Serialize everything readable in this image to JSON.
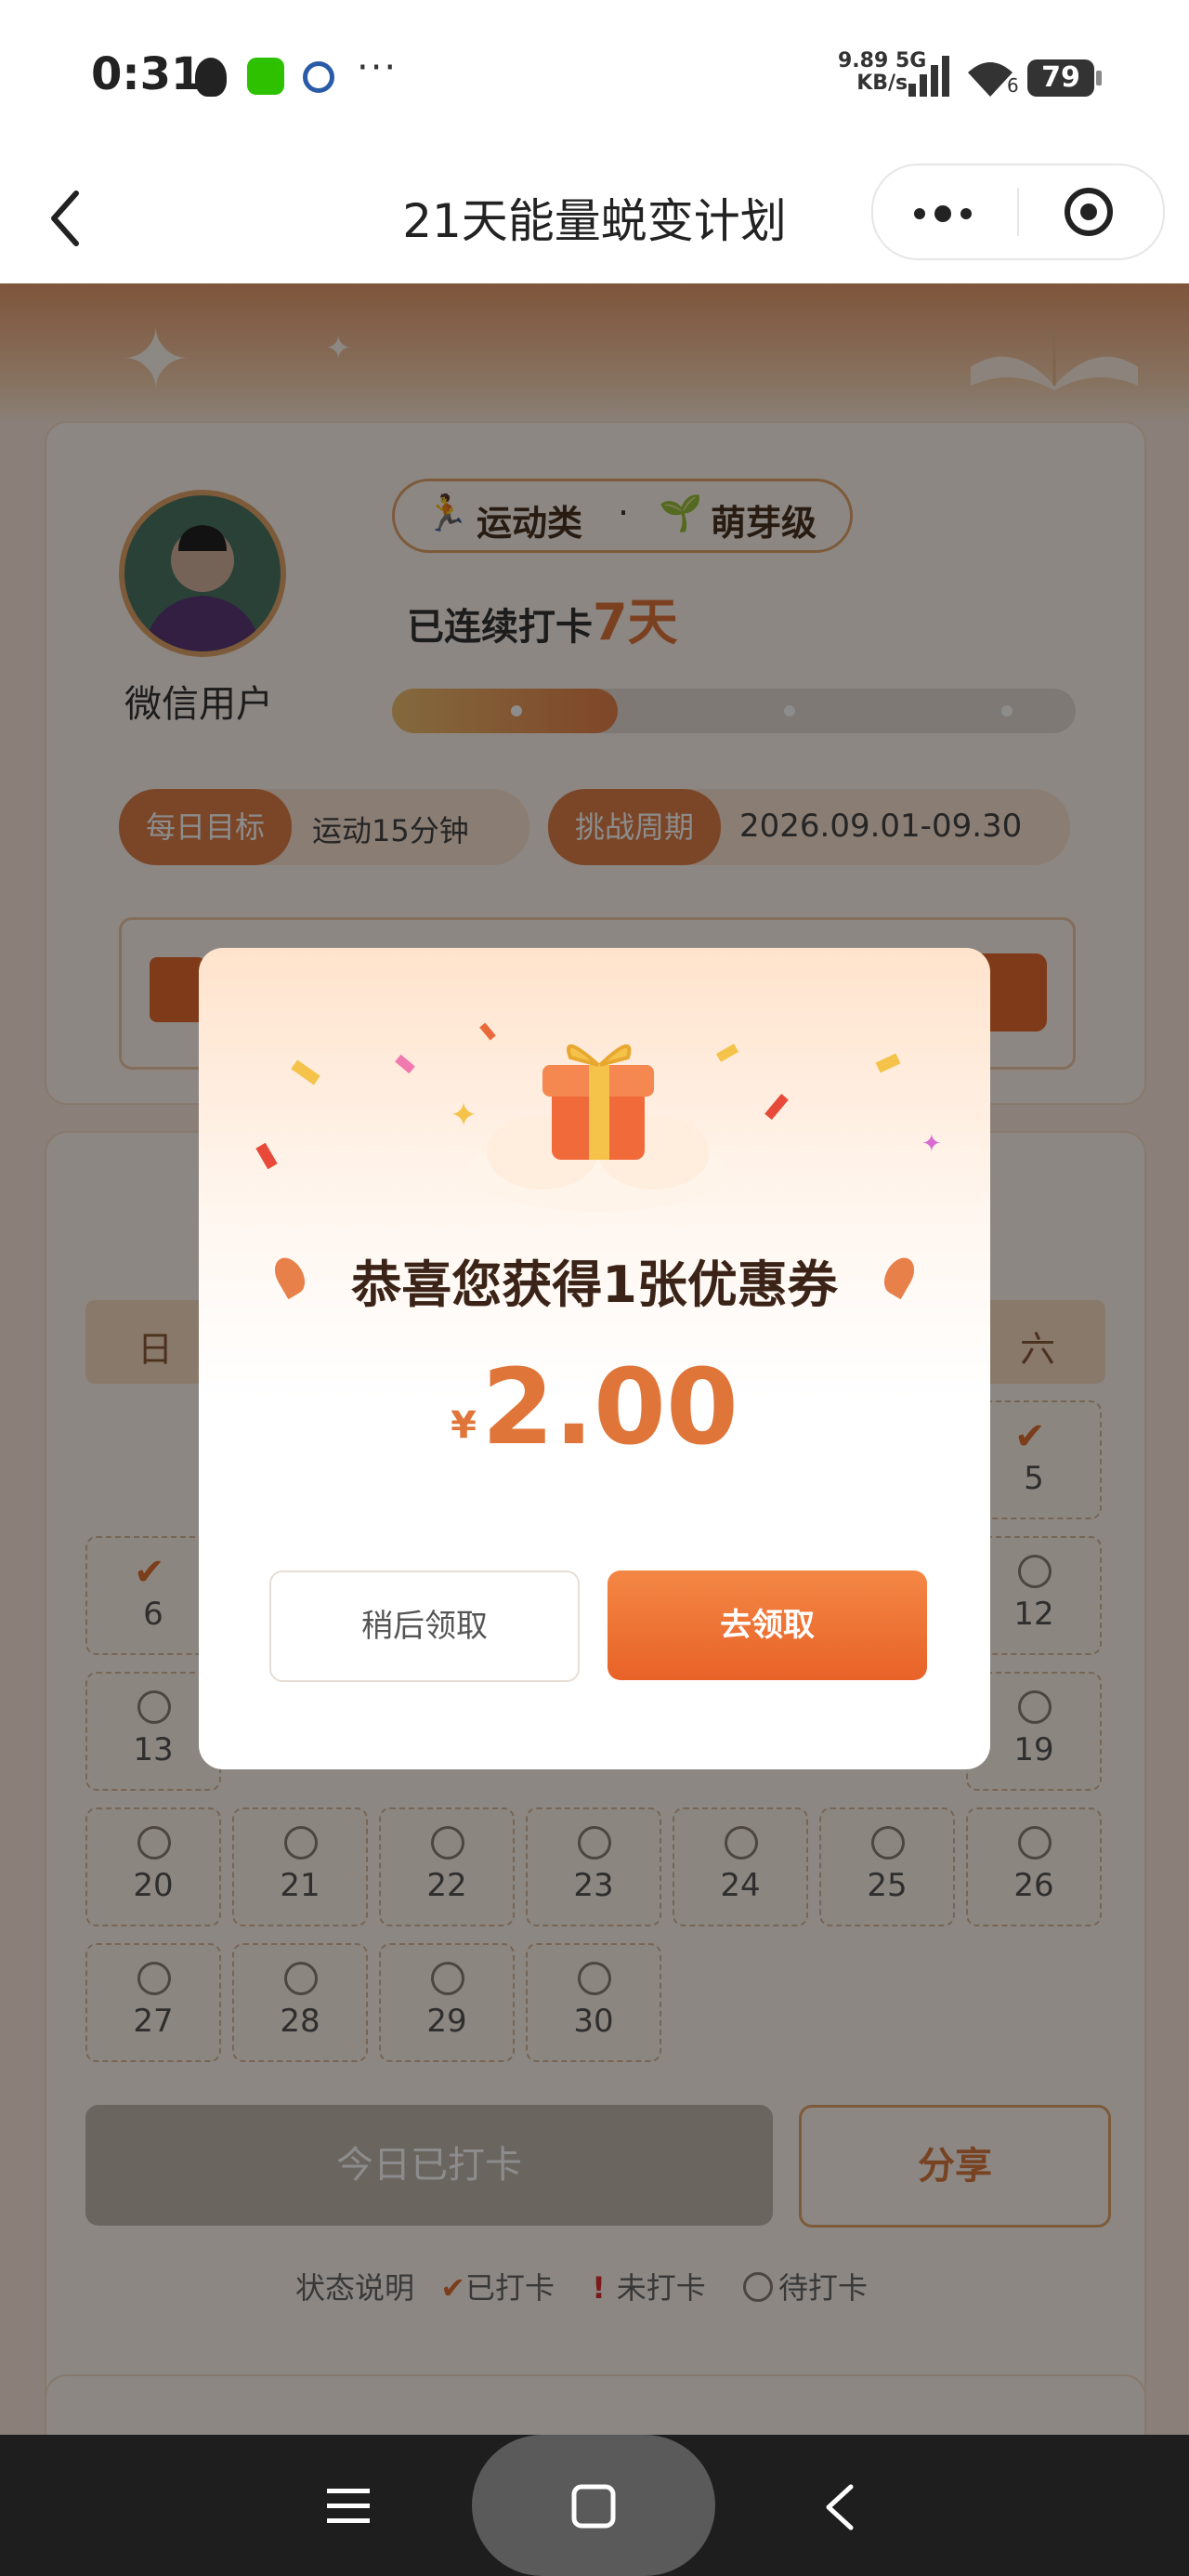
{
  "status_bar": {
    "time": "0:31",
    "dots": "···",
    "net_speed": "9.89",
    "net_unit": "KB/s",
    "net_type": "5G",
    "wifi_sub": "6",
    "battery": "79"
  },
  "navbar": {
    "title": "21天能量蜕变计划"
  },
  "profile": {
    "username": "微信用户",
    "category": "运动类",
    "separator": "·",
    "level": "萌芽级",
    "streak_prefix": "已连续打卡",
    "streak_value": "7天",
    "progress": 0.33
  },
  "chips": {
    "goal_label": "每日目标",
    "goal_value": "运动15分钟",
    "period_label": "挑战周期",
    "period_value": "2026.09.01-09.30"
  },
  "calendar": {
    "weekday_first": "日",
    "weekday_last": "六",
    "cells": [
      {
        "day": "5",
        "checked": true
      },
      {
        "day": "6",
        "checked": true
      },
      {
        "day": "12",
        "checked": false
      },
      {
        "day": "13",
        "checked": false
      },
      {
        "day": "19",
        "checked": false
      },
      {
        "day": "20",
        "checked": false
      },
      {
        "day": "21",
        "checked": false
      },
      {
        "day": "22",
        "checked": false
      },
      {
        "day": "23",
        "checked": false
      },
      {
        "day": "24",
        "checked": false
      },
      {
        "day": "25",
        "checked": false
      },
      {
        "day": "26",
        "checked": false
      },
      {
        "day": "27",
        "checked": false
      },
      {
        "day": "28",
        "checked": false
      },
      {
        "day": "29",
        "checked": false
      },
      {
        "day": "30",
        "checked": false
      }
    ],
    "checkin_btn": "今日已打卡",
    "share_btn": "分享",
    "legend_title": "状态说明",
    "legend_done": "已打卡",
    "legend_missed": "未打卡",
    "legend_pending": "待打卡"
  },
  "modal": {
    "title": "恭喜您获得1张优惠券",
    "currency": "¥",
    "amount": "2.00",
    "later_btn": "稍后领取",
    "go_btn": "去领取"
  }
}
